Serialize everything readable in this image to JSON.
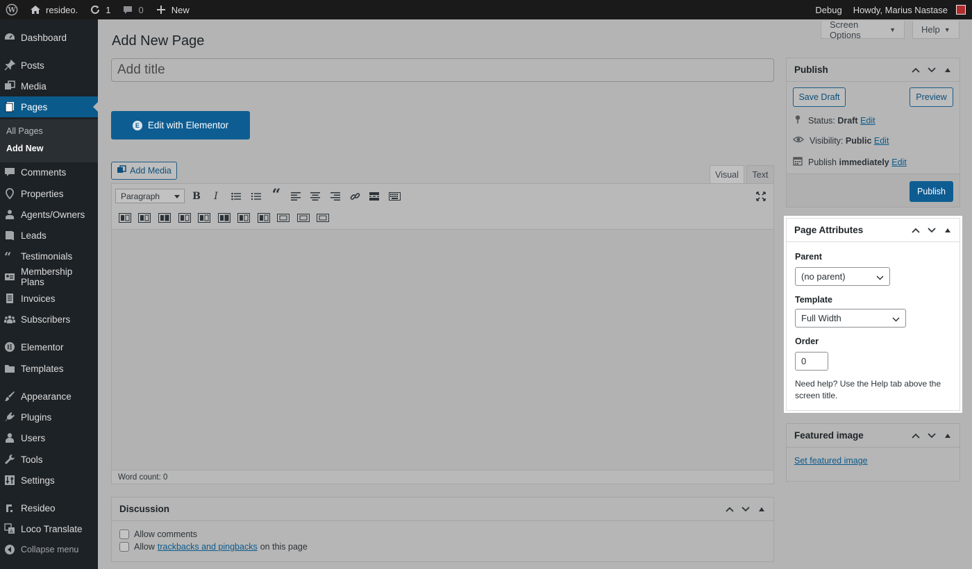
{
  "adminbar": {
    "site_name": "resideo.",
    "updates_count": "1",
    "comments_count": "0",
    "new_label": "New",
    "debug_label": "Debug",
    "howdy": "Howdy, Marius Nastase"
  },
  "sidebar": {
    "items": [
      {
        "label": "Dashboard",
        "icon": "dashboard-icon"
      },
      {
        "label": "Posts",
        "icon": "pin-icon"
      },
      {
        "label": "Media",
        "icon": "media-icon"
      },
      {
        "label": "Pages",
        "icon": "pages-icon"
      },
      {
        "label": "Comments",
        "icon": "comment-icon"
      },
      {
        "label": "Properties",
        "icon": "location-icon"
      },
      {
        "label": "Agents/Owners",
        "icon": "person-icon"
      },
      {
        "label": "Leads",
        "icon": "book-icon"
      },
      {
        "label": "Testimonials",
        "icon": "quote-icon"
      },
      {
        "label": "Membership Plans",
        "icon": "id-card-icon"
      },
      {
        "label": "Invoices",
        "icon": "document-icon"
      },
      {
        "label": "Subscribers",
        "icon": "groups-icon"
      },
      {
        "label": "Elementor",
        "icon": "elementor-icon"
      },
      {
        "label": "Templates",
        "icon": "folder-icon"
      },
      {
        "label": "Appearance",
        "icon": "brush-icon"
      },
      {
        "label": "Plugins",
        "icon": "plug-icon"
      },
      {
        "label": "Users",
        "icon": "user-icon"
      },
      {
        "label": "Tools",
        "icon": "wrench-icon"
      },
      {
        "label": "Settings",
        "icon": "settings-icon"
      },
      {
        "label": "Resideo",
        "icon": "resideo-icon"
      },
      {
        "label": "Loco Translate",
        "icon": "translate-icon"
      },
      {
        "label": "Collapse menu",
        "icon": "collapse-icon"
      }
    ],
    "submenu": [
      "All Pages",
      "Add New"
    ]
  },
  "screen_options": "Screen Options",
  "help": "Help",
  "page_title": "Add New Page",
  "title_placeholder": "Add title",
  "edit_with_elementor": "Edit with Elementor",
  "add_media": "Add Media",
  "editor_tabs": {
    "visual": "Visual",
    "text": "Text"
  },
  "format_select": "Paragraph",
  "word_count": "Word count: 0",
  "publish": {
    "title": "Publish",
    "save_draft": "Save Draft",
    "preview": "Preview",
    "status_label": "Status:",
    "status_value": "Draft",
    "visibility_label": "Visibility:",
    "visibility_value": "Public",
    "publish_label": "Publish",
    "publish_value": "immediately",
    "edit": "Edit",
    "publish_button": "Publish"
  },
  "page_attributes": {
    "title": "Page Attributes",
    "parent_label": "Parent",
    "parent_value": "(no parent)",
    "template_label": "Template",
    "template_value": "Full Width",
    "order_label": "Order",
    "order_value": "0",
    "help": "Need help? Use the Help tab above the screen title."
  },
  "featured_image": {
    "title": "Featured image",
    "link": "Set featured image"
  },
  "discussion": {
    "title": "Discussion",
    "allow_comments": "Allow comments",
    "allow_prefix": "Allow",
    "trackbacks_link": "trackbacks and pingbacks",
    "allow_suffix": "on this page"
  },
  "colors": {
    "accent": "#0e5d92",
    "sidebar_bg": "#1d2226",
    "adminbar_bg": "#1a1a1a",
    "avatar": "#b32d2e"
  }
}
